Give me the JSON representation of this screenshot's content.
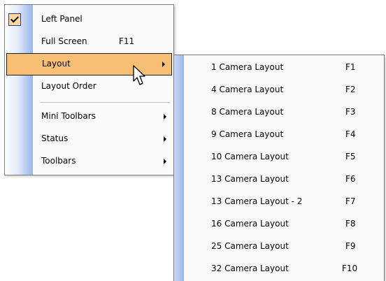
{
  "main_menu": {
    "items": [
      {
        "label": "Left Panel",
        "shortcut": "",
        "checked": true
      },
      {
        "label": "Full Screen",
        "shortcut": "F11"
      },
      {
        "label": "Layout",
        "shortcut": "",
        "submenu": true,
        "highlighted": true
      },
      {
        "label": "Layout Order",
        "shortcut": ""
      },
      {
        "label": "Mini Toolbars",
        "shortcut": "",
        "submenu": true
      },
      {
        "label": "Status",
        "shortcut": "",
        "submenu": true
      },
      {
        "label": "Toolbars",
        "shortcut": "",
        "submenu": true
      }
    ],
    "icons": {
      "check": "checkmark-icon",
      "submenu": "submenu-arrow-icon",
      "cursor": "mouse-pointer-icon"
    }
  },
  "layout_submenu": {
    "items": [
      {
        "label": "1 Camera Layout",
        "shortcut": "F1"
      },
      {
        "label": "4 Camera Layout",
        "shortcut": "F2"
      },
      {
        "label": "8 Camera Layout",
        "shortcut": "F3"
      },
      {
        "label": "9 Camera Layout",
        "shortcut": "F4"
      },
      {
        "label": "10 Camera Layout",
        "shortcut": "F5"
      },
      {
        "label": "13 Camera Layout",
        "shortcut": "F6"
      },
      {
        "label": "13 Camera Layout - 2",
        "shortcut": "F7"
      },
      {
        "label": "16 Camera Layout",
        "shortcut": "F8"
      },
      {
        "label": "25 Camera Layout",
        "shortcut": "F9"
      },
      {
        "label": "32 Camera Layout",
        "shortcut": "F10"
      }
    ]
  },
  "colors": {
    "highlight": "#f6bf74",
    "gutter": "#9ab6ec",
    "menu_bg": "#fbfbfb",
    "border": "#7a7a7a"
  }
}
